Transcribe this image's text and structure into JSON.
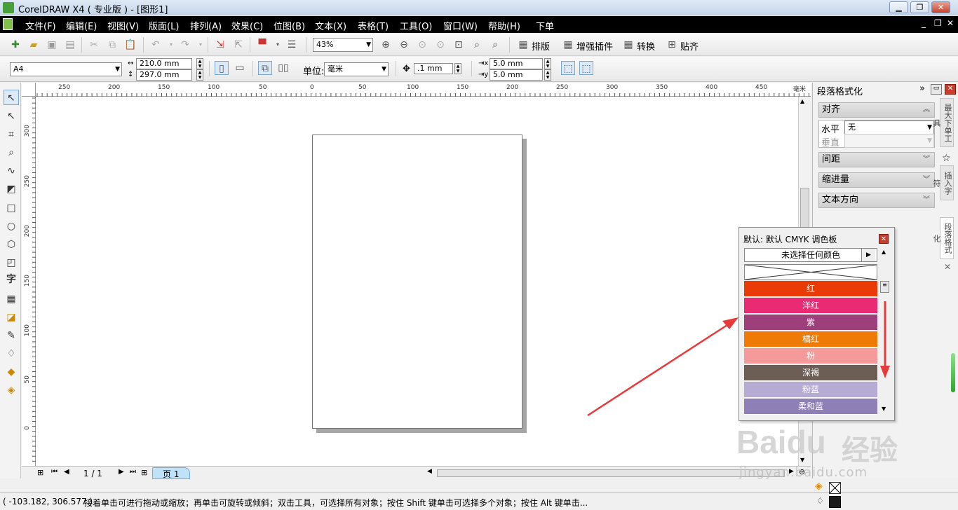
{
  "window": {
    "title": "CorelDRAW X4 ( 专业版 ) - [图形1]",
    "min_icon": "minimize-icon",
    "max_icon": "maximize-icon",
    "close_icon": "close-icon"
  },
  "menu": {
    "items": [
      "文件(F)",
      "编辑(E)",
      "视图(V)",
      "版面(L)",
      "排列(A)",
      "效果(C)",
      "位图(B)",
      "文本(X)",
      "表格(T)",
      "工具(O)",
      "窗口(W)",
      "帮助(H)",
      "下单"
    ]
  },
  "toolbar": {
    "zoom": "43%",
    "buttons": [
      "排版",
      "增强插件",
      "转换",
      "贴齐"
    ]
  },
  "property_bar": {
    "paper": "A4",
    "width": "210.0 mm",
    "height": "297.0 mm",
    "unit_label": "单位:",
    "unit": "毫米",
    "nudge": ".1 mm",
    "dup_x": "5.0 mm",
    "dup_y": "5.0 mm"
  },
  "ruler": {
    "unit": "毫米",
    "h_labels": [
      "250",
      "200",
      "150",
      "100",
      "50",
      "0",
      "50",
      "100",
      "150",
      "200",
      "250",
      "300",
      "350",
      "400",
      "450"
    ],
    "v_labels": [
      "300",
      "250",
      "200",
      "150",
      "100",
      "50",
      "0"
    ]
  },
  "navigator": {
    "page_count": "1 / 1",
    "page_tab": "页 1"
  },
  "docker": {
    "title": "段落格式化",
    "sections": {
      "align": "对齐",
      "horizontal_label": "水平",
      "horizontal_value": "无",
      "vertical_label": "垂直",
      "spacing": "间距",
      "indent": "缩进量",
      "direction": "文本方向"
    },
    "side_tabs": [
      "最大下单工具",
      "插入字符",
      "段落格式化"
    ]
  },
  "palette": {
    "title": "默认: 默认 CMYK 调色板",
    "no_color": "未选择任何颜色",
    "swatches": [
      {
        "name": "红",
        "color": "#ea3b06"
      },
      {
        "name": "洋红",
        "color": "#ea2a73"
      },
      {
        "name": "紫",
        "color": "#9c3f7a"
      },
      {
        "name": "橘红",
        "color": "#ef7a05"
      },
      {
        "name": "粉",
        "color": "#f59a9a"
      },
      {
        "name": "深褐",
        "color": "#6d5e55"
      },
      {
        "name": "粉蓝",
        "color": "#b6abd2"
      },
      {
        "name": "柔和蓝",
        "color": "#8f7fb7"
      }
    ]
  },
  "status": {
    "coords": "( -103.182, 306.577 )",
    "hint": "接着单击可进行拖动或缩放；再单击可旋转或倾斜；双击工具，可选择所有对象；按住 Shift 键单击可选择多个对象；按住 Alt 键单击..."
  },
  "watermark": {
    "brand": "Baidu",
    "text": "经验",
    "url": "jingyan.baidu.com"
  },
  "colors": {
    "annotation_arrow": "#e83a3a"
  }
}
